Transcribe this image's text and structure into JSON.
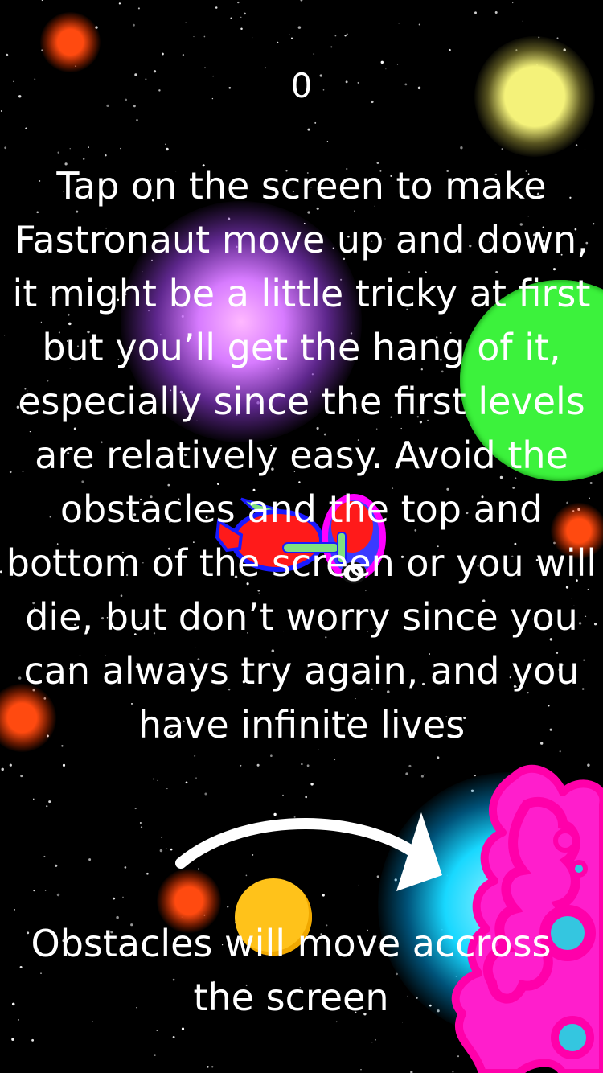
{
  "hud": {
    "score": "0"
  },
  "tutorial": {
    "instructions": "Tap on the screen to make Fastronaut move up and down, it might be a little tricky at first but you’ll get the hang of it, especially since the first levels are relatively easy. Avoid the obstacles and the top and bottom of the screen or you will die, but don’t worry since you can always try again, and you have infinite lives",
    "obstacle_caption": "Obstacles will move accross the screen"
  },
  "colors": {
    "background": "#000000",
    "text": "#ffffff",
    "nebula_purple": "#d77bff",
    "planet_green": "#3cf23c",
    "glow_yellow": "#f4f27a",
    "glow_orange": "#ff4a10",
    "glow_cyan": "#18d8ff",
    "obstacle_magenta": "#ff00ff",
    "ship_red": "#ff1a1a",
    "ship_blue": "#3a3aff",
    "coin_yellow": "#ffc21a"
  },
  "icons": {
    "player": "fastronaut-ship-icon",
    "obstacle": "spiky-blob-obstacle-icon",
    "arrow": "curved-arrow-icon",
    "coin": "coin-icon"
  }
}
